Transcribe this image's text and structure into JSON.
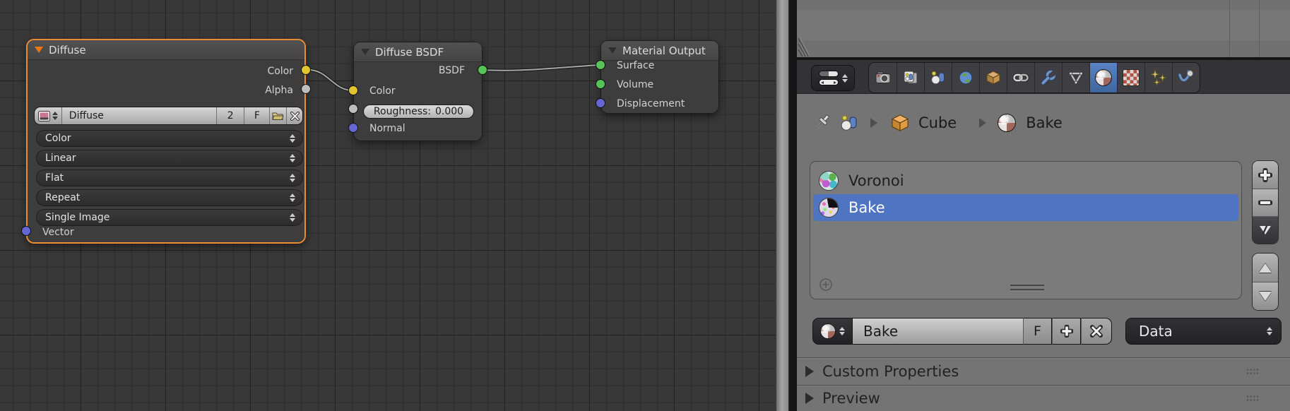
{
  "node_editor": {
    "nodes": {
      "diffuse": {
        "title": "Diffuse",
        "outputs": [
          "Color",
          "Alpha"
        ],
        "datablock": {
          "name": "Diffuse",
          "users": "2",
          "fake_user": "F"
        },
        "dropdowns": [
          "Color",
          "Linear",
          "Flat",
          "Repeat",
          "Single Image"
        ],
        "inputs": [
          "Vector"
        ]
      },
      "diffuse_bsdf": {
        "title": "Diffuse BSDF",
        "outputs": [
          "BSDF"
        ],
        "inputs": [
          "Color",
          "Normal"
        ],
        "roughness_label": "Roughness:",
        "roughness_value": "0.000"
      },
      "material_output": {
        "title": "Material Output",
        "inputs": [
          "Surface",
          "Volume",
          "Displacement"
        ]
      }
    }
  },
  "properties": {
    "tabs": [
      "render",
      "render-layers",
      "scene",
      "world",
      "object",
      "constraints",
      "modifiers",
      "object-data",
      "material",
      "texture",
      "particles",
      "physics"
    ],
    "active_tab": "material",
    "breadcrumb": {
      "object": "Cube",
      "material": "Bake"
    },
    "material_slots": {
      "items": [
        {
          "name": "Voronoi"
        },
        {
          "name": "Bake"
        }
      ],
      "selected": "Bake"
    },
    "name_field": {
      "value": "Bake",
      "fake_user_label": "F"
    },
    "data_source_label": "Data",
    "panels": [
      {
        "label": "Custom Properties"
      },
      {
        "label": "Preview"
      }
    ]
  },
  "colors": {
    "node_select_outline": "#ec8b33",
    "selection_blue": "#4f74c2",
    "tab_active_blue": "#4a74b8",
    "socket_color_yellow": "#e0c430",
    "socket_shader_green": "#55c355",
    "socket_vector_blue": "#6467d3",
    "socket_value_gray": "#bdbdbd"
  }
}
